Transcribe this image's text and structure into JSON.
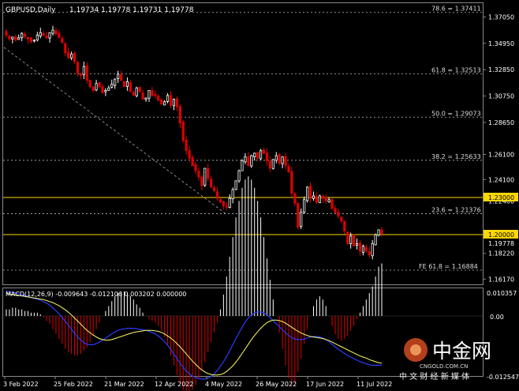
{
  "header": {
    "symbol": "GBPUSD,Daily",
    "ohlc": "1.19734 1.19778 1.19731 1.19778"
  },
  "levels": {
    "line_1230": "1.23000",
    "line_1200": "1.20000",
    "last_price": "1.19778"
  },
  "fib": [
    {
      "label": "78.6 = 1.37411",
      "price": 1.37411
    },
    {
      "label": "61.8 = 1.32513",
      "price": 1.32513
    },
    {
      "label": "50.0 = 1.29073",
      "price": 1.29073
    },
    {
      "label": "38.2 = 1.25633",
      "price": 1.25633
    },
    {
      "label": "23.6 = 1.21376",
      "price": 1.21376
    },
    {
      "label": "FE 61.8 = 1.16884",
      "price": 1.16884
    }
  ],
  "macd": {
    "label": "MACD(12,26,9) -0.009643 -0.012106 0.003202 0.000000",
    "axis_top": "0.010357",
    "axis_zero": "0.00",
    "axis_bottom": "-0.012547"
  },
  "colors": {
    "bull": "#ffffff",
    "bear": "#e00000",
    "level": "#ffd700",
    "macd_line": "#2a3cff",
    "signal_line": "#ffff66"
  },
  "watermark": {
    "brand": "中金网",
    "domain": "CNGOLD.COM.CN",
    "slogan": "中 文 财 经 新 媒 体"
  },
  "chart_data": {
    "type": "candlestick",
    "title": "GBPUSD,Daily",
    "ylim": [
      1.1575,
      1.3815
    ],
    "y_ticks": [
      "1.37050",
      "1.34950",
      "1.32850",
      "1.30750",
      "1.28650",
      "1.26100",
      "1.24100",
      "1.22400",
      "1.20000",
      "1.18220",
      "1.16170"
    ],
    "x_ticks": [
      "3 Feb 2022",
      "25 Feb 2022",
      "21 Mar 2022",
      "12 Apr 2022",
      "4 May 2022",
      "26 May 2022",
      "17 Jun 2022",
      "11 Jul 2022"
    ],
    "closes": [
      1.356,
      1.353,
      1.3545,
      1.352,
      1.354,
      1.3575,
      1.355,
      1.353,
      1.351,
      1.352,
      1.356,
      1.358,
      1.356,
      1.354,
      1.358,
      1.36,
      1.357,
      1.354,
      1.35,
      1.342,
      1.338,
      1.341,
      1.335,
      1.326,
      1.324,
      1.331,
      1.32,
      1.315,
      1.312,
      1.3175,
      1.315,
      1.31,
      1.312,
      1.314,
      1.317,
      1.321,
      1.325,
      1.32,
      1.315,
      1.319,
      1.311,
      1.308,
      1.314,
      1.311,
      1.305,
      1.306,
      1.312,
      1.308,
      1.308,
      1.304,
      1.301,
      1.303,
      1.308,
      1.3,
      1.305,
      1.299,
      1.286,
      1.272,
      1.264,
      1.258,
      1.252,
      1.248,
      1.243,
      1.236,
      1.25,
      1.242,
      1.235,
      1.232,
      1.226,
      1.223,
      1.22,
      1.219,
      1.226,
      1.233,
      1.24,
      1.248,
      1.256,
      1.259,
      1.252,
      1.26,
      1.262,
      1.258,
      1.264,
      1.262,
      1.256,
      1.25,
      1.257,
      1.26,
      1.254,
      1.259,
      1.252,
      1.247,
      1.23,
      1.222,
      1.203,
      1.215,
      1.225,
      1.235,
      1.226,
      1.228,
      1.223,
      1.228,
      1.226,
      1.224,
      1.225,
      1.218,
      1.215,
      1.212,
      1.208,
      1.2,
      1.19,
      1.196,
      1.188,
      1.19,
      1.184,
      1.188,
      1.184,
      1.181,
      1.19,
      1.197,
      1.201,
      1.1978
    ],
    "macd_hist": [
      0.0004,
      0.0004,
      0.0005,
      0.0005,
      0.0004,
      0.0004,
      0.0003,
      0.0003,
      0.0002,
      0.0002,
      0.0002,
      0.0001,
      -0.0001,
      -0.0003,
      -0.0005,
      -0.0008,
      -0.0011,
      -0.0014,
      -0.0017,
      -0.002,
      -0.0022,
      -0.0023,
      -0.0024,
      -0.0024,
      -0.0023,
      -0.0021,
      -0.0019,
      -0.0016,
      -0.0012,
      -0.0008,
      -0.0004,
      0.0,
      0.0003,
      0.0006,
      0.0009,
      0.0012,
      0.0014,
      0.0015,
      0.0015,
      0.0014,
      0.0012,
      0.001,
      0.0007,
      0.0005,
      0.0002,
      0.0,
      -0.0002,
      -0.0003,
      -0.0004,
      -0.0006,
      -0.0009,
      -0.0013,
      -0.0018,
      -0.0024,
      -0.003,
      -0.0036,
      -0.0041,
      -0.0045,
      -0.0047,
      -0.0047,
      -0.0045,
      -0.0042,
      -0.0038,
      -0.0033,
      -0.0028,
      -0.0022,
      -0.0016,
      -0.001,
      -0.0004,
      0.0004,
      0.0013,
      0.0024,
      0.0036,
      0.0048,
      0.006,
      0.007,
      0.0078,
      0.0083,
      0.0085,
      0.0083,
      0.0078,
      0.007,
      0.006,
      0.0048,
      0.0035,
      0.0022,
      0.001,
      0.0,
      -0.001,
      -0.002,
      -0.003,
      -0.0038,
      -0.0042,
      -0.004,
      -0.0034,
      -0.0026,
      -0.0017,
      -0.0008,
      0.0,
      0.0006,
      0.001,
      0.0012,
      0.001,
      0.0006,
      0.0,
      -0.0006,
      -0.0011,
      -0.0014,
      -0.0015,
      -0.0014,
      -0.0012,
      -0.0009,
      -0.0006,
      -0.0002,
      0.0002,
      0.0006,
      0.001,
      0.0014,
      0.0018,
      0.0024,
      0.003,
      0.0032
    ],
    "macd_line": [
      0.0048,
      0.0047,
      0.0046,
      0.0045,
      0.0043,
      0.0042,
      0.004,
      0.0038,
      0.0036,
      0.0034,
      0.0033,
      0.0031,
      0.0028,
      0.0025,
      0.0021,
      0.0016,
      0.001,
      0.0004,
      -0.0003,
      -0.001,
      -0.0018,
      -0.0026,
      -0.0034,
      -0.0041,
      -0.0047,
      -0.0052,
      -0.0055,
      -0.0056,
      -0.0056,
      -0.0054,
      -0.0051,
      -0.0047,
      -0.0043,
      -0.0039,
      -0.0035,
      -0.0031,
      -0.0028,
      -0.0026,
      -0.0025,
      -0.0024,
      -0.0024,
      -0.0024,
      -0.0025,
      -0.0026,
      -0.0027,
      -0.0028,
      -0.003,
      -0.0032,
      -0.0035,
      -0.0039,
      -0.0044,
      -0.005,
      -0.0057,
      -0.0065,
      -0.0074,
      -0.0083,
      -0.0092,
      -0.01,
      -0.0107,
      -0.0113,
      -0.0117,
      -0.012,
      -0.0122,
      -0.0123,
      -0.0123,
      -0.0121,
      -0.0118,
      -0.0113,
      -0.0106,
      -0.0098,
      -0.0089,
      -0.0079,
      -0.0068,
      -0.0056,
      -0.0044,
      -0.0033,
      -0.0022,
      -0.0012,
      -0.0004,
      0.0002,
      0.0006,
      0.0008,
      0.0008,
      0.0006,
      0.0002,
      -0.0003,
      -0.0009,
      -0.0015,
      -0.0021,
      -0.0027,
      -0.0033,
      -0.0038,
      -0.0042,
      -0.0045,
      -0.0046,
      -0.0046,
      -0.0045,
      -0.0043,
      -0.0041,
      -0.004,
      -0.004,
      -0.0041,
      -0.0043,
      -0.0046,
      -0.005,
      -0.0055,
      -0.006,
      -0.0065,
      -0.0069,
      -0.0073,
      -0.0077,
      -0.008,
      -0.0083,
      -0.0086,
      -0.0089,
      -0.0091,
      -0.0093,
      -0.0095,
      -0.0096,
      -0.0096,
      -0.0096,
      -0.0096
    ],
    "signal_line": [
      0.0044,
      0.0043,
      0.0042,
      0.0041,
      0.004,
      0.0039,
      0.0038,
      0.0037,
      0.0036,
      0.0035,
      0.0034,
      0.0033,
      0.0032,
      0.003,
      0.0028,
      0.0026,
      0.0023,
      0.002,
      0.0016,
      0.0012,
      0.0007,
      0.0002,
      -0.0004,
      -0.001,
      -0.0016,
      -0.0022,
      -0.0028,
      -0.0033,
      -0.0037,
      -0.0041,
      -0.0044,
      -0.0046,
      -0.0047,
      -0.0047,
      -0.0046,
      -0.0044,
      -0.0042,
      -0.004,
      -0.0038,
      -0.0036,
      -0.0034,
      -0.0032,
      -0.0031,
      -0.003,
      -0.0029,
      -0.0028,
      -0.0028,
      -0.0028,
      -0.0029,
      -0.003,
      -0.0032,
      -0.0035,
      -0.0039,
      -0.0043,
      -0.0048,
      -0.0054,
      -0.006,
      -0.0067,
      -0.0074,
      -0.0081,
      -0.0088,
      -0.0094,
      -0.01,
      -0.0105,
      -0.0109,
      -0.0112,
      -0.0114,
      -0.0115,
      -0.0115,
      -0.0114,
      -0.0112,
      -0.0108,
      -0.0103,
      -0.0097,
      -0.009,
      -0.0082,
      -0.0073,
      -0.0064,
      -0.0055,
      -0.0046,
      -0.0038,
      -0.0031,
      -0.0024,
      -0.0018,
      -0.0013,
      -0.001,
      -0.0008,
      -0.0008,
      -0.0009,
      -0.0011,
      -0.0014,
      -0.0018,
      -0.0022,
      -0.0026,
      -0.003,
      -0.0033,
      -0.0036,
      -0.0038,
      -0.004,
      -0.0041,
      -0.0042,
      -0.0043,
      -0.0044,
      -0.0046,
      -0.0048,
      -0.0051,
      -0.0054,
      -0.0057,
      -0.006,
      -0.0063,
      -0.0066,
      -0.0069,
      -0.0072,
      -0.0075,
      -0.0078,
      -0.008,
      -0.0082,
      -0.0085,
      -0.0087,
      -0.0089,
      -0.0091,
      -0.0092
    ]
  }
}
